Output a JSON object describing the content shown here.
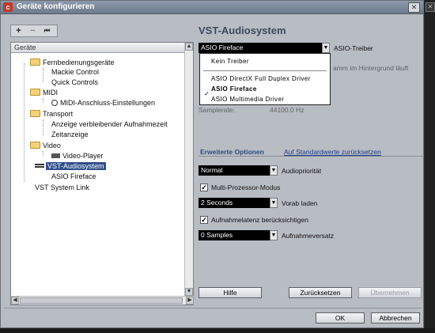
{
  "window": {
    "title": "Geräte konfigurieren"
  },
  "toolbar": {
    "add": "+",
    "remove": "−",
    "reset": "⏮"
  },
  "tree": {
    "header": "Geräte",
    "nodes": [
      {
        "label": "Fernbedienungsgeräte"
      },
      {
        "label": "Mackie Control"
      },
      {
        "label": "Quick Controls"
      },
      {
        "label": "MIDI"
      },
      {
        "label": "MIDI-Anschluss-Einstellungen"
      },
      {
        "label": "Transport"
      },
      {
        "label": "Anzeige verbleibender Aufnahmezeit"
      },
      {
        "label": "Zeitanzeige"
      },
      {
        "label": "Video"
      },
      {
        "label": "Video-Player"
      },
      {
        "label": "VST-Audiosystem"
      },
      {
        "label": "ASIO Fireface"
      },
      {
        "label": "VST System Link"
      }
    ]
  },
  "vst": {
    "title": "VST-Audiosystem",
    "driver_value": "ASIO Fireface",
    "driver_label": "ASIO-Treiber",
    "driver_options": [
      "Kein Treiber",
      "ASIO DirectX Full Duplex Driver",
      "ASIO Fireface",
      "ASIO Multimedia Driver"
    ],
    "background_text": "amm im Hintergrund läuft",
    "samplerate_label": "Samplerate:",
    "samplerate_value": "44100.0 Hz"
  },
  "advanced": {
    "tab_label": "Erweiterte Optionen",
    "reset_link": "Auf Standardwerte zurücksetzen",
    "priority_value": "Normal",
    "priority_label": "Audiopriorität",
    "multiproc_label": "Multi-Prozessor-Modus",
    "preload_value": "2 Seconds",
    "preload_label": "Vorab laden",
    "latency_label": "Aufnahmelatenz berücksichtigen",
    "offset_value": "0 Samples",
    "offset_label": "Aufnahmeversatz"
  },
  "buttons": {
    "help": "Hilfe",
    "reset": "Zurücksetzen",
    "apply": "Übernehmen",
    "ok": "OK",
    "cancel": "Abbrechen"
  },
  "colors": {
    "selection": "#2f4f8c",
    "link": "#1f3c88",
    "title": "#3c4a5e"
  }
}
